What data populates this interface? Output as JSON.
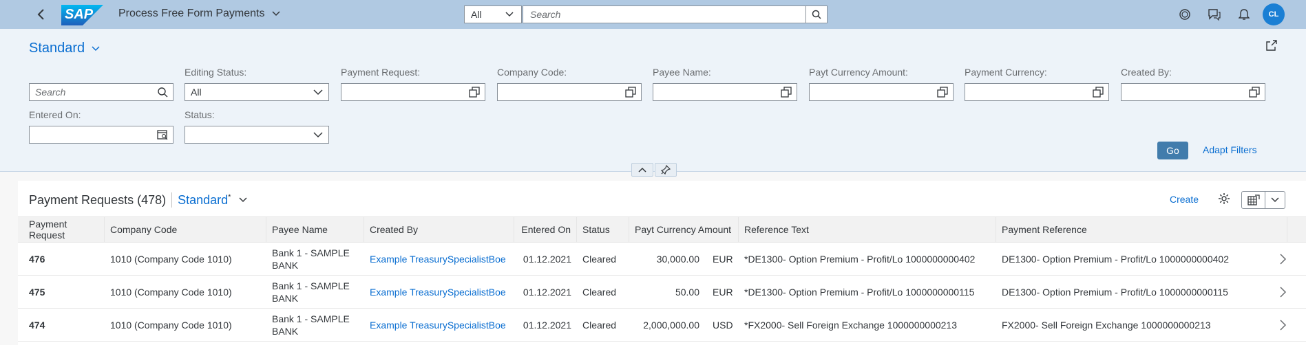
{
  "shell": {
    "app_title": "Process Free Form Payments",
    "search_scope": "All",
    "search_placeholder": "Search",
    "avatar_initials": "CL",
    "logo_text": "SAP"
  },
  "header": {
    "variant": "Standard",
    "filters": [
      {
        "label": "",
        "value": "",
        "placeholder": "Search"
      },
      {
        "label": "Editing Status:",
        "value": "All",
        "placeholder": ""
      },
      {
        "label": "Payment Request:",
        "value": "",
        "placeholder": ""
      },
      {
        "label": "Company Code:",
        "value": "",
        "placeholder": ""
      },
      {
        "label": "Payee Name:",
        "value": "",
        "placeholder": ""
      },
      {
        "label": "Payt Currency Amount:",
        "value": "",
        "placeholder": ""
      },
      {
        "label": "Payment Currency:",
        "value": "",
        "placeholder": ""
      },
      {
        "label": "Created By:",
        "value": "",
        "placeholder": ""
      },
      {
        "label": "Entered On:",
        "value": "",
        "placeholder": ""
      },
      {
        "label": "Status:",
        "value": "",
        "placeholder": ""
      }
    ],
    "go_label": "Go",
    "adapt_filters_label": "Adapt Filters"
  },
  "table": {
    "title": "Payment Requests (478)",
    "variant": "Standard",
    "variant_modified_marker": "*",
    "create_label": "Create",
    "columns": [
      "Payment Request",
      "Company Code",
      "Payee Name",
      "Created By",
      "Entered On",
      "Status",
      "Payt Currency Amount",
      "Reference Text",
      "Payment Reference"
    ],
    "rows": [
      {
        "request": "476",
        "company": "1010 (Company Code 1010)",
        "payee_line1": "Bank 1 - SAMPLE",
        "payee_line2": "BANK",
        "created_by": "Example TreasurySpecialistBoe",
        "entered_on": "01.12.2021",
        "status": "Cleared",
        "amount": "30,000.00",
        "currency": "EUR",
        "reference_text": "*DE1300- Option Premium - Profit/Lo 1000000000402",
        "payment_reference": "DE1300- Option Premium - Profit/Lo 1000000000402"
      },
      {
        "request": "475",
        "company": "1010 (Company Code 1010)",
        "payee_line1": "Bank 1 - SAMPLE",
        "payee_line2": "BANK",
        "created_by": "Example TreasurySpecialistBoe",
        "entered_on": "01.12.2021",
        "status": "Cleared",
        "amount": "50.00",
        "currency": "EUR",
        "reference_text": "*DE1300- Option Premium - Profit/Lo 1000000000115",
        "payment_reference": "DE1300- Option Premium - Profit/Lo 1000000000115"
      },
      {
        "request": "474",
        "company": "1010 (Company Code 1010)",
        "payee_line1": "Bank 1 - SAMPLE",
        "payee_line2": "BANK",
        "created_by": "Example TreasurySpecialistBoe",
        "entered_on": "01.12.2021",
        "status": "Cleared",
        "amount": "2,000,000.00",
        "currency": "USD",
        "reference_text": "*FX2000- Sell Foreign Exchange 1000000000213",
        "payment_reference": "FX2000- Sell Foreign Exchange 1000000000213"
      }
    ]
  },
  "colors": {
    "shell_bg": "#b0c9e2",
    "header_bg": "#edf3f9",
    "accent": "#0a6ed1",
    "go_button": "#427cac",
    "avatar": "#1a7fd4"
  }
}
